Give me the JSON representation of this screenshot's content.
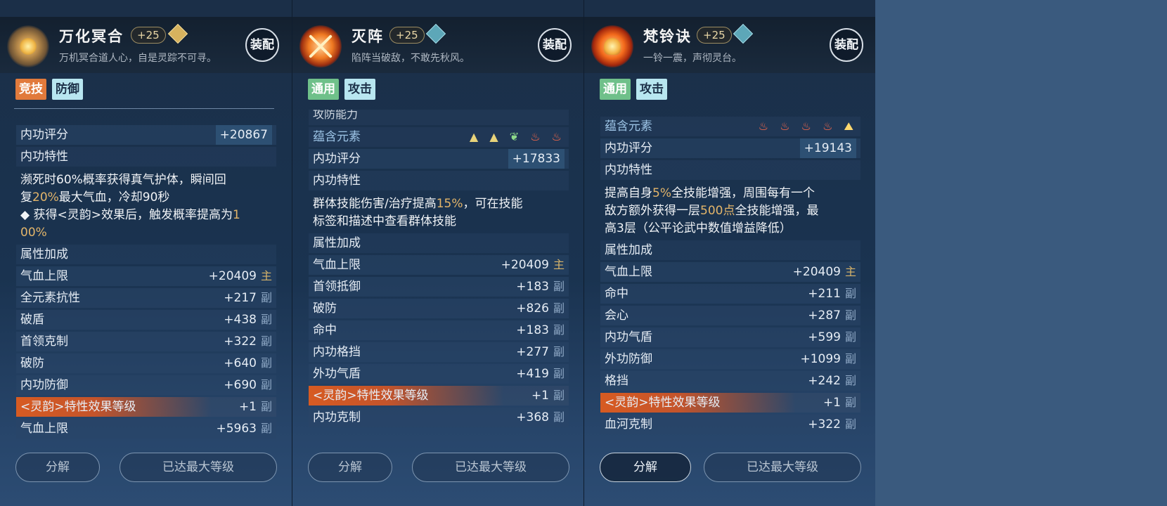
{
  "panels": [
    {
      "title": "万化冥合",
      "level": "+25",
      "subtitle": "万机冥合道人心，自是灵踪不可寻。",
      "equip_label": "装配",
      "tags": [
        "竞技",
        "防御"
      ],
      "score_label": "内功评分",
      "score_value": "+20867",
      "trait_label": "内功特性",
      "trait_desc_1": "濒死时60%概率获得真气护体，瞬间回",
      "trait_desc_2a": "复",
      "trait_desc_2b": "20%",
      "trait_desc_2c": "最大气血，冷却90秒",
      "trait_desc_3a": " ◆ 获得<灵韵>效果后，触发概率提高为",
      "trait_desc_3b": "1",
      "trait_desc_4": "00%",
      "attr_label": "属性加成",
      "attrs": [
        {
          "name": "气血上限",
          "value": "+20409",
          "side": "主"
        },
        {
          "name": "全元素抗性",
          "value": "+217",
          "side": "副"
        },
        {
          "name": "破盾",
          "value": "+438",
          "side": "副"
        },
        {
          "name": "首领克制",
          "value": "+322",
          "side": "副"
        },
        {
          "name": "破防",
          "value": "+640",
          "side": "副"
        },
        {
          "name": "内功防御",
          "value": "+690",
          "side": "副"
        },
        {
          "name": "<灵韵>特性效果等级",
          "value": "+1",
          "side": "副"
        },
        {
          "name": "气血上限",
          "value": "+5963",
          "side": "副"
        }
      ],
      "btn_decompose": "分解",
      "btn_max": "已达最大等级"
    },
    {
      "title": "灭阵",
      "level": "+25",
      "subtitle": "陷阵当破敌，不敢先秋风。",
      "equip_label": "装配",
      "tags": [
        "通用",
        "攻击"
      ],
      "partial_row": "攻防能力",
      "element_label": "蕴含元素",
      "score_label": "内功评分",
      "score_value": "+17833",
      "trait_label": "内功特性",
      "trait_desc_1a": "群体技能伤害/治疗提高",
      "trait_desc_1b": "15%",
      "trait_desc_1c": "，可在技能",
      "trait_desc_2": "标签和描述中查看群体技能",
      "attr_label": "属性加成",
      "attrs": [
        {
          "name": "气血上限",
          "value": "+20409",
          "side": "主"
        },
        {
          "name": "首领抵御",
          "value": "+183",
          "side": "副"
        },
        {
          "name": "破防",
          "value": "+826",
          "side": "副"
        },
        {
          "name": "命中",
          "value": "+183",
          "side": "副"
        },
        {
          "name": "内功格挡",
          "value": "+277",
          "side": "副"
        },
        {
          "name": "外功气盾",
          "value": "+419",
          "side": "副"
        },
        {
          "name": "<灵韵>特性效果等级",
          "value": "+1",
          "side": "副"
        },
        {
          "name": "内功克制",
          "value": "+368",
          "side": "副"
        }
      ],
      "btn_decompose": "分解",
      "btn_max": "已达最大等级"
    },
    {
      "title": "梵铃诀",
      "level": "+25",
      "subtitle": "一铃一震，声彻灵台。",
      "equip_label": "装配",
      "tags": [
        "通用",
        "攻击"
      ],
      "element_label": "蕴含元素",
      "score_label": "内功评分",
      "score_value": "+19143",
      "trait_label": "内功特性",
      "trait_desc_1a": "提高自身",
      "trait_desc_1b": "5%",
      "trait_desc_1c": "全技能增强，周围每有一个",
      "trait_desc_2a": "敌方额外获得一层",
      "trait_desc_2b": "500点",
      "trait_desc_2c": "全技能增强，最",
      "trait_desc_3": "高3层（公平论武中数值增益降低）",
      "attr_label": "属性加成",
      "attrs": [
        {
          "name": "气血上限",
          "value": "+20409",
          "side": "主"
        },
        {
          "name": "命中",
          "value": "+211",
          "side": "副"
        },
        {
          "name": "会心",
          "value": "+287",
          "side": "副"
        },
        {
          "name": "内功气盾",
          "value": "+599",
          "side": "副"
        },
        {
          "name": "外功防御",
          "value": "+1099",
          "side": "副"
        },
        {
          "name": "格挡",
          "value": "+242",
          "side": "副"
        },
        {
          "name": "<灵韵>特性效果等级",
          "value": "+1",
          "side": "副"
        },
        {
          "name": "血河克制",
          "value": "+322",
          "side": "副"
        }
      ],
      "btn_decompose": "分解",
      "btn_max": "已达最大等级"
    }
  ],
  "icons": {
    "element_triangle": "▲",
    "element_leaf": "❦",
    "element_fire": "♨",
    "element_gold": "⛰"
  }
}
